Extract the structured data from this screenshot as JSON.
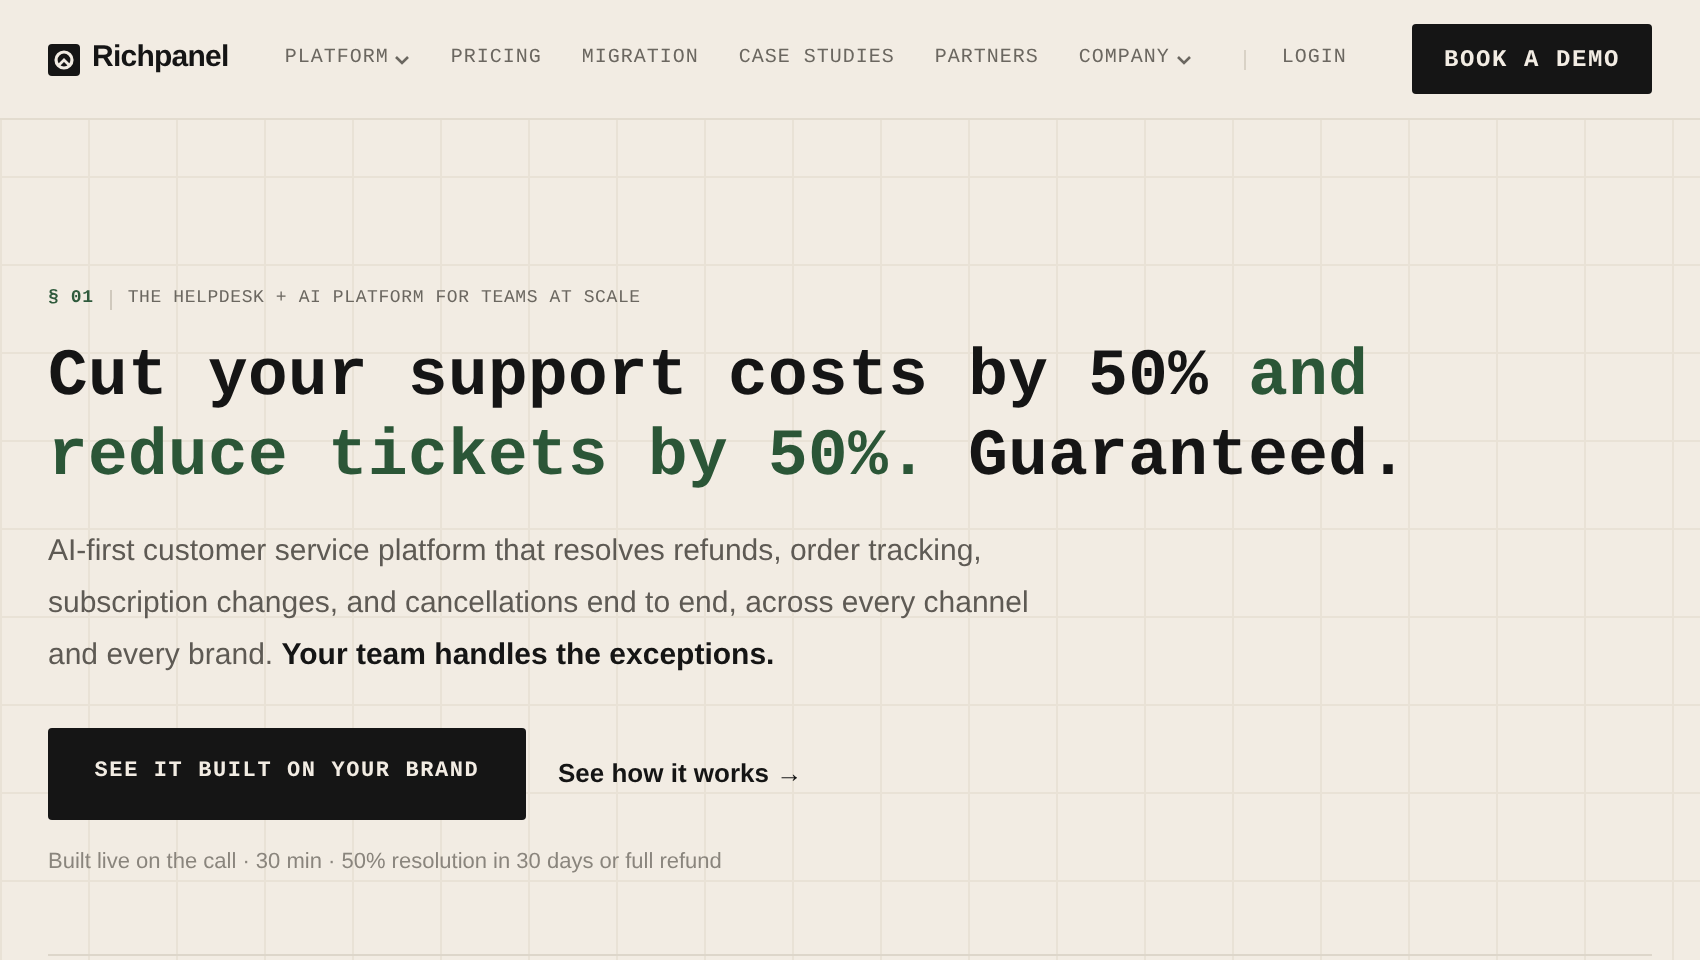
{
  "header": {
    "brand": "Richpanel",
    "nav": [
      {
        "label": "PLATFORM",
        "dropdown": true
      },
      {
        "label": "PRICING",
        "dropdown": false
      },
      {
        "label": "MIGRATION",
        "dropdown": false
      },
      {
        "label": "CASE STUDIES",
        "dropdown": false
      },
      {
        "label": "PARTNERS",
        "dropdown": false
      },
      {
        "label": "COMPANY",
        "dropdown": true
      }
    ],
    "login": "LOGIN",
    "cta": "BOOK A DEMO"
  },
  "hero": {
    "section_number": "§ 01",
    "eyebrow": "THE HELPDESK + AI PLATFORM FOR TEAMS AT SCALE",
    "headline": [
      {
        "text": "Cut your support costs by 50% ",
        "accent": false
      },
      {
        "text": "and reduce tickets by 50%.",
        "accent": true
      },
      {
        "text": " Guaranteed.",
        "accent": false
      }
    ],
    "description": "AI-first customer service platform that resolves refunds, order tracking, subscription changes, and cancellations end to end, across every channel and every brand. **Your team handles the exceptions.**",
    "primary_button": "SEE IT BUILT ON YOUR BRAND",
    "secondary_link": "See how it works →",
    "footnote": "Built live on the call · 30 min · 50% resolution in 30 days or full refund"
  }
}
